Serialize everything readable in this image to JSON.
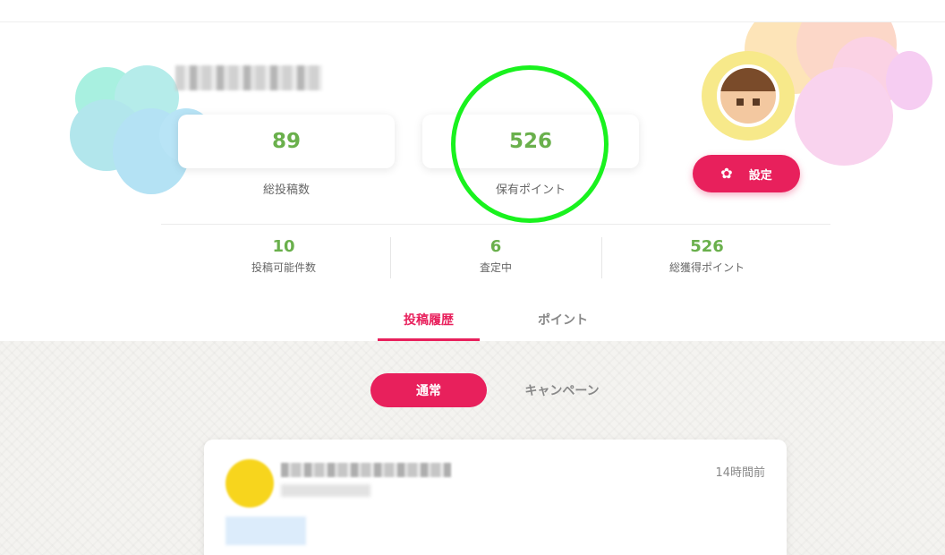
{
  "profile": {
    "stats_cards": [
      {
        "value": "89",
        "label": "総投稿数"
      },
      {
        "value": "526",
        "label": "保有ポイント"
      }
    ],
    "settings_label": "設定",
    "mini_stats": [
      {
        "value": "10",
        "label": "投稿可能件数"
      },
      {
        "value": "6",
        "label": "査定中"
      },
      {
        "value": "526",
        "label": "総獲得ポイント"
      }
    ]
  },
  "tabs": [
    {
      "label": "投稿履歴",
      "active": true
    },
    {
      "label": "ポイント",
      "active": false
    }
  ],
  "filter_pills": [
    {
      "label": "通常",
      "active": true
    },
    {
      "label": "キャンペーン",
      "active": false
    }
  ],
  "post": {
    "time": "14時間前"
  },
  "colors": {
    "accent": "#e8205c",
    "stat_green": "#6ab04c",
    "highlight_ring": "#19f21e"
  }
}
